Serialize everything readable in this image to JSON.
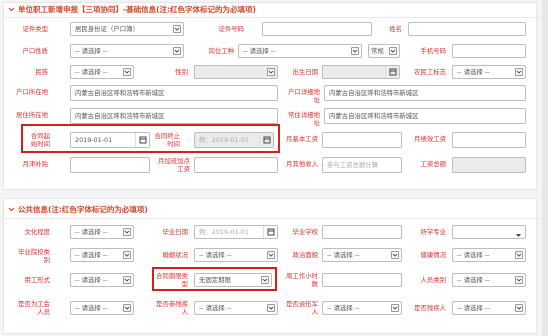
{
  "section1": {
    "title": "单位职工新增申报【三项协同】-基础信息(注:红色字体标记的为必填项)"
  },
  "section2": {
    "title": "公共信息(注:红色字体标记的为必填项)"
  },
  "form1": {
    "id_type_label": "证件类型",
    "id_type_value": "居民身份证（户口簿）",
    "id_no_label": "证件号码",
    "name_label": "姓名",
    "hukou_nature_label": "户口性质",
    "hukou_nature_value": "-- 请选择 --",
    "work_type_label": "岗位工种",
    "work_type_value": "-- 请选择 --",
    "permanent_label": "常规",
    "phone_label": "手机号码",
    "nation_label": "民族",
    "nation_value": "-- 请选择 --",
    "gender_label": "性别",
    "birth_label": "出生日期",
    "farmer_label": "农民工标志",
    "farmer_value": "-- 请选择 --",
    "hukou_place_label": "户口所在地",
    "hukou_place_value": "内蒙古自治区呼和浩特市新城区",
    "hukou_addr_label": "户口详细地址",
    "hukou_addr_value": "内蒙古自治区呼和浩特市新城区",
    "residence_label": "居住所在地",
    "residence_value": "内蒙古自治区呼和浩特市新城区",
    "residence_addr_label": "常住详细地址",
    "residence_addr_value": "内蒙古自治区呼和浩特市新城区",
    "contract_start_label": "合同起始时间",
    "contract_start_value": "2019-01-01",
    "contract_end_label": "合同终止时间",
    "contract_end_placeholder": "例：2019-01-01",
    "monthly_base_label": "月基本工资",
    "monthly_perf_label": "月绩效工资",
    "monthly_subsidy_label": "月津补贴",
    "monthly_overtime_label": "月加班加点工资",
    "monthly_other_label": "月其他收入",
    "monthly_other_placeholder": "参与工资总额计算",
    "total_label": "工资总额"
  },
  "form2": {
    "edu_label": "文化程度",
    "edu_value": "-- 请选择 --",
    "grad_date_label": "毕业日期",
    "grad_date_placeholder": "例：2019-01-01",
    "school_label": "毕业学校",
    "major_label": "所学专业",
    "grad_school_label": "毕业院校类别",
    "grad_school_value": "-- 请选择 --",
    "marital_label": "婚姻状况",
    "marital_value": "-- 请选择 --",
    "political_label": "政治面貌",
    "political_value": "-- 请选择 --",
    "health_label": "健康情况",
    "health_value": "-- 请选择 --",
    "emp_form_label": "用工形式",
    "emp_form_value": "-- 请选择 --",
    "contract_type_label": "合同期限类型",
    "contract_type_value": "无固定期限",
    "weekly_hours_label": "周工作小时数",
    "staff_cat_label": "人员类别",
    "staff_cat_value": "-- 请选择 --",
    "union_label": "是否为工会人员",
    "union_value": "-- 请选择 --",
    "disability_label": "是否参残疾人",
    "disability_value": "-- 请选择 --",
    "retired_label": "是否退伍军人",
    "retired_value": "-- 请选择 --",
    "minority_label": "是否残疾人",
    "minority_value": "-- 请选择 --"
  },
  "colors": {
    "required": "#e03030",
    "title": "#d24a2b",
    "highlight": "#d51f1f"
  }
}
